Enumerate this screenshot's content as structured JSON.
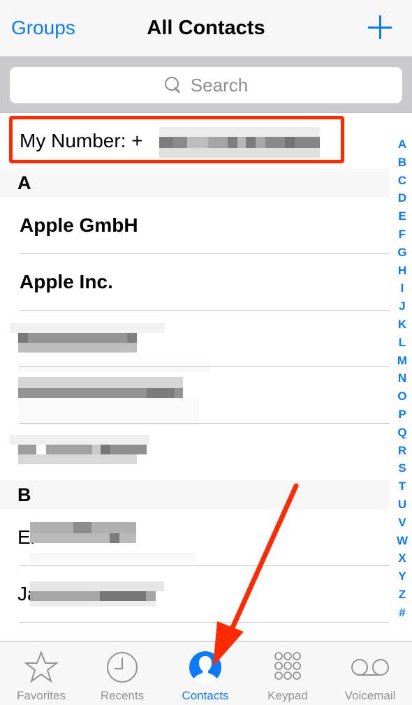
{
  "navbar": {
    "left_label": "Groups",
    "title": "All Contacts",
    "add_icon": "plus-icon"
  },
  "search": {
    "placeholder": "Search",
    "icon": "search-icon"
  },
  "my_number": {
    "label": "My Number: +",
    "value_redacted": true
  },
  "sections": [
    {
      "letter": "A",
      "contacts": [
        {
          "name": "Apple GmbH",
          "redacted": false
        },
        {
          "name": "Apple Inc.",
          "redacted": false
        },
        {
          "name": "",
          "redacted": true
        },
        {
          "name": "",
          "redacted": true
        },
        {
          "name": "",
          "redacted": true
        }
      ]
    },
    {
      "letter": "B",
      "contacts": [
        {
          "name": "Ei",
          "redacted": true
        },
        {
          "name": "Ja",
          "redacted": true
        }
      ]
    }
  ],
  "index": [
    "A",
    "B",
    "C",
    "D",
    "E",
    "F",
    "G",
    "H",
    "I",
    "J",
    "K",
    "L",
    "M",
    "N",
    "O",
    "P",
    "Q",
    "R",
    "S",
    "T",
    "U",
    "V",
    "W",
    "X",
    "Y",
    "Z",
    "#"
  ],
  "tabbar": {
    "tabs": [
      {
        "label": "Favorites",
        "icon": "star-icon",
        "active": false
      },
      {
        "label": "Recents",
        "icon": "clock-icon",
        "active": false
      },
      {
        "label": "Contacts",
        "icon": "person-icon",
        "active": true
      },
      {
        "label": "Keypad",
        "icon": "keypad-icon",
        "active": false
      },
      {
        "label": "Voicemail",
        "icon": "voicemail-icon",
        "active": false
      }
    ]
  },
  "colors": {
    "accent": "#0a7aff",
    "annotation": "#ff2a00",
    "inactive": "#929292"
  },
  "annotations": {
    "highlight_box_target": "my-number-row",
    "arrow_target": "tab-contacts"
  }
}
